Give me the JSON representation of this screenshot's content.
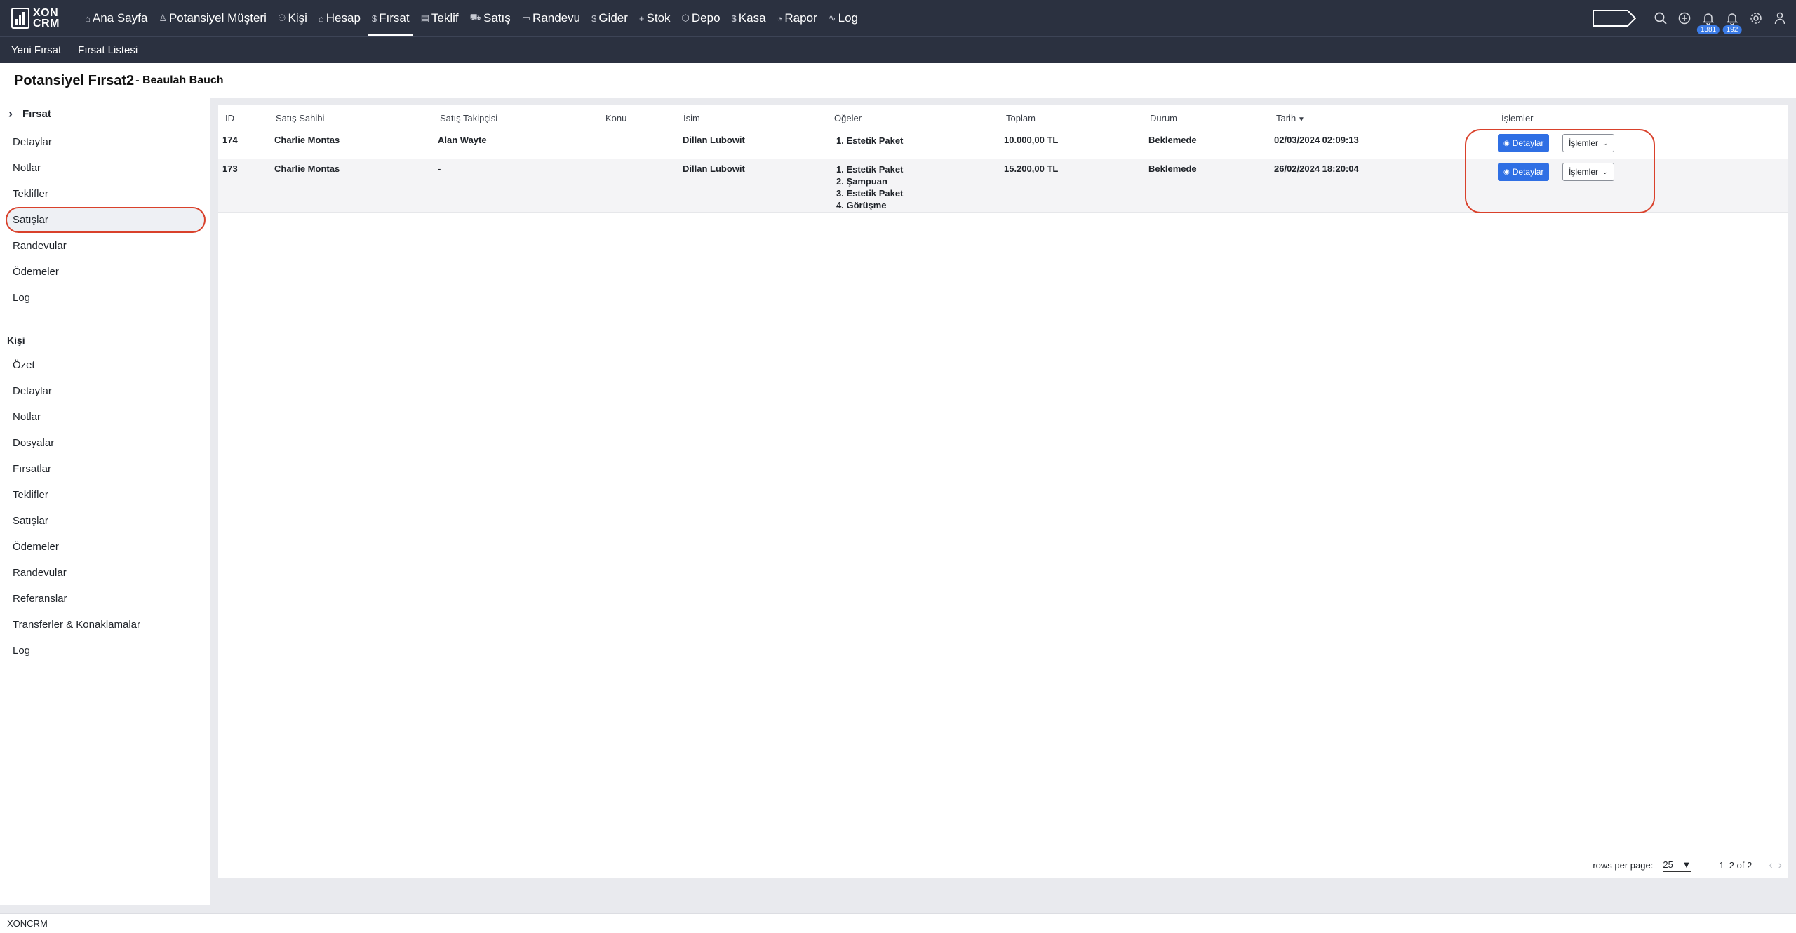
{
  "brand": {
    "line1": "XON",
    "line2": "CRM"
  },
  "nav": {
    "items": [
      {
        "label": "Ana Sayfa",
        "icon": "⌂",
        "icon_name": "home-icon"
      },
      {
        "label": "Potansiyel Müşteri",
        "icon": "♙",
        "icon_name": "person-icon"
      },
      {
        "label": "Kişi",
        "icon": "⚇",
        "icon_name": "people-icon"
      },
      {
        "label": "Hesap",
        "icon": "⌂",
        "icon_name": "building-icon"
      },
      {
        "label": "Fırsat",
        "icon": "$",
        "icon_name": "dollar-icon",
        "active": true
      },
      {
        "label": "Teklif",
        "icon": "▤",
        "icon_name": "document-icon"
      },
      {
        "label": "Satış",
        "icon": "⛟",
        "icon_name": "cart-icon"
      },
      {
        "label": "Randevu",
        "icon": "▭",
        "icon_name": "calendar-icon"
      },
      {
        "label": "Gider",
        "icon": "$",
        "icon_name": "dollar-icon"
      },
      {
        "label": "Stok",
        "icon": "+",
        "icon_name": "plus-icon"
      },
      {
        "label": "Depo",
        "icon": "⬡",
        "icon_name": "warehouse-icon"
      },
      {
        "label": "Kasa",
        "icon": "$",
        "icon_name": "dollar-icon"
      },
      {
        "label": "Rapor",
        "icon": "◔",
        "icon_name": "report-icon"
      },
      {
        "label": "Log",
        "icon": "∿",
        "icon_name": "activity-icon"
      }
    ],
    "badges": {
      "notifications_1": "1381",
      "notifications_2": "192"
    }
  },
  "subnav": {
    "items": [
      "Yeni Fırsat",
      "Fırsat Listesi"
    ]
  },
  "page": {
    "title": "Potansiyel Fırsat2",
    "subtitle": "- Beaulah Bauch"
  },
  "sidebar": {
    "header": "Fırsat",
    "group1": [
      "Detaylar",
      "Notlar",
      "Teklifler",
      "Satışlar",
      "Randevular",
      "Ödemeler",
      "Log"
    ],
    "selected": "Satışlar",
    "section2": "Kişi",
    "group2": [
      "Özet",
      "Detaylar",
      "Notlar",
      "Dosyalar",
      "Fırsatlar",
      "Teklifler",
      "Satışlar",
      "Ödemeler",
      "Randevular",
      "Referanslar",
      "Transferler & Konaklamalar",
      "Log"
    ]
  },
  "table": {
    "columns": [
      "ID",
      "Satış Sahibi",
      "Satış Takipçisi",
      "Konu",
      "İsim",
      "Öğeler",
      "Toplam",
      "Durum",
      "Tarih",
      "İşlemler"
    ],
    "rows": [
      {
        "id": "174",
        "owner": "Charlie Montas",
        "follower": "Alan Wayte",
        "subject": "",
        "name": "Dillan Lubowit",
        "items": [
          "1. Estetik Paket"
        ],
        "total": "10.000,00 TL",
        "status": "Beklemede",
        "date": "02/03/2024 02:09:13"
      },
      {
        "id": "173",
        "owner": "Charlie Montas",
        "follower": "-",
        "subject": "",
        "name": "Dillan Lubowit",
        "items": [
          "1. Estetik Paket",
          "2. Şampuan",
          "3. Estetik Paket",
          "4. Görüşme"
        ],
        "total": "15.200,00 TL",
        "status": "Beklemede",
        "date": "26/02/2024 18:20:04"
      }
    ],
    "details_button": "Detaylar",
    "actions_button": "İşlemler"
  },
  "pagination": {
    "rows_per_page_label": "rows per page:",
    "rows_per_page": "25",
    "range": "1–2 of 2"
  },
  "footer": {
    "text": "XONCRM"
  }
}
